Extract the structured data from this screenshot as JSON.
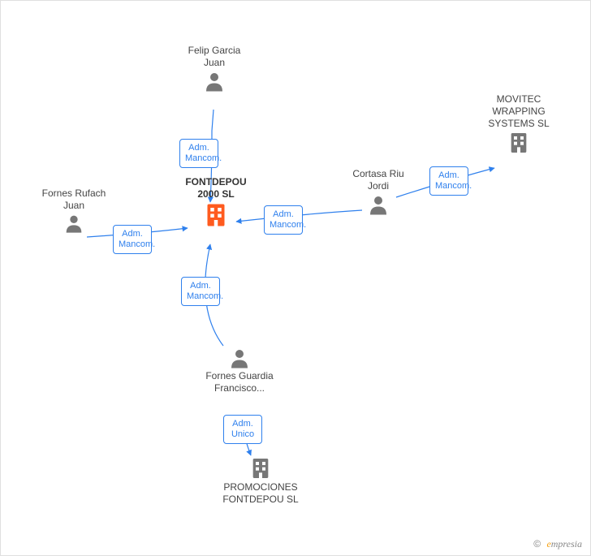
{
  "footer": {
    "copyright": "©",
    "brand_e": "e",
    "brand_rest": "mpresia"
  },
  "colors": {
    "edge": "#2f80ed",
    "person": "#777777",
    "companyGray": "#777777",
    "companyOrange": "#ff5b1f",
    "labelBorder": "#2f80ed"
  },
  "labels": {
    "admMancom": "Adm. Mancom.",
    "admUnico": "Adm. Unico"
  },
  "nodes": {
    "center": {
      "label": "FONTDEPOU 2000 SL"
    },
    "felip": {
      "label": "Felip Garcia Juan"
    },
    "fornesR": {
      "label": "Fornes Rufach Juan"
    },
    "cortasa": {
      "label": "Cortasa Riu Jordi"
    },
    "movitec": {
      "label": "MOVITEC WRAPPING SYSTEMS SL"
    },
    "fornesG": {
      "label": "Fornes Guardia Francisco..."
    },
    "promo": {
      "label": "PROMOCIONES FONTDEPOU SL"
    }
  },
  "diagram": {
    "type": "entity-relationship",
    "center": "FONTDEPOU 2000 SL",
    "entities": [
      {
        "id": "center",
        "name": "FONTDEPOU 2000 SL",
        "kind": "company",
        "highlight": true
      },
      {
        "id": "felip",
        "name": "Felip Garcia Juan",
        "kind": "person"
      },
      {
        "id": "fornesR",
        "name": "Fornes Rufach Juan",
        "kind": "person"
      },
      {
        "id": "cortasa",
        "name": "Cortasa Riu Jordi",
        "kind": "person"
      },
      {
        "id": "fornesG",
        "name": "Fornes Guardia Francisco...",
        "kind": "person"
      },
      {
        "id": "movitec",
        "name": "MOVITEC WRAPPING SYSTEMS SL",
        "kind": "company"
      },
      {
        "id": "promo",
        "name": "PROMOCIONES FONTDEPOU SL",
        "kind": "company"
      }
    ],
    "relationships": [
      {
        "from": "felip",
        "to": "center",
        "role": "Adm. Mancom."
      },
      {
        "from": "fornesR",
        "to": "center",
        "role": "Adm. Mancom."
      },
      {
        "from": "cortasa",
        "to": "center",
        "role": "Adm. Mancom."
      },
      {
        "from": "cortasa",
        "to": "movitec",
        "role": "Adm. Mancom."
      },
      {
        "from": "fornesG",
        "to": "center",
        "role": "Adm. Mancom."
      },
      {
        "from": "fornesG",
        "to": "promo",
        "role": "Adm. Unico"
      }
    ]
  }
}
